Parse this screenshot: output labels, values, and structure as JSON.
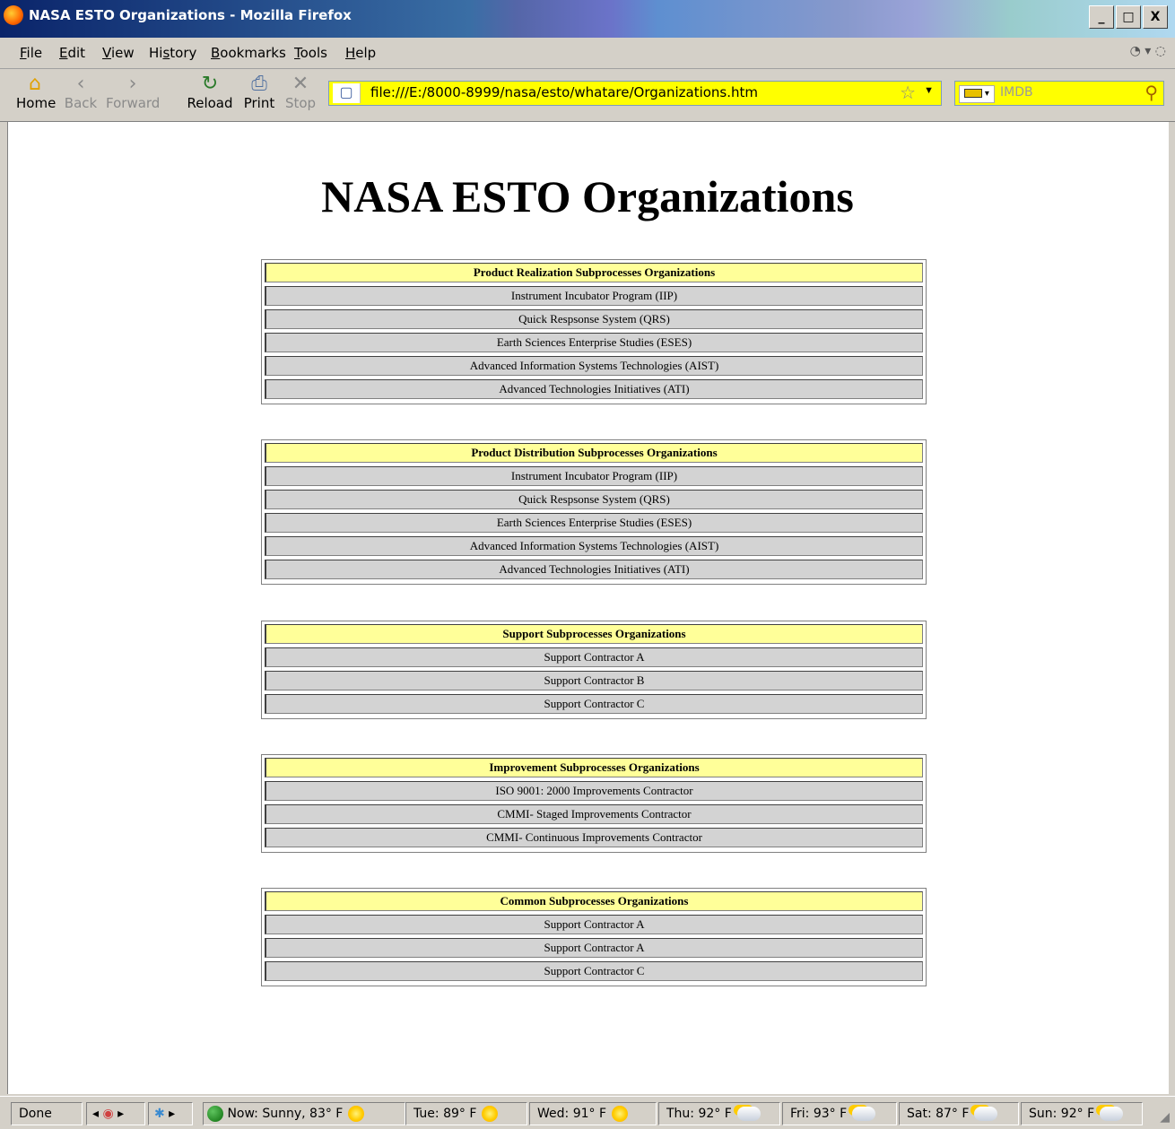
{
  "window": {
    "title": "NASA ESTO Organizations - Mozilla Firefox",
    "controls": {
      "minimize": "_",
      "maximize": "□",
      "close": "X"
    }
  },
  "menu": {
    "items": [
      {
        "label": "File",
        "key": "F",
        "rest": "ile"
      },
      {
        "label": "Edit",
        "key": "E",
        "rest": "dit"
      },
      {
        "label": "View",
        "key": "V",
        "rest": "iew"
      },
      {
        "label": "History",
        "key": "s",
        "pre": "Hi",
        "rest": "tory"
      },
      {
        "label": "Bookmarks",
        "key": "B",
        "rest": "ookmarks"
      },
      {
        "label": "Tools",
        "key": "T",
        "rest": "ools"
      },
      {
        "label": "Help",
        "key": "H",
        "rest": "elp"
      }
    ]
  },
  "toolbar": {
    "home": "Home",
    "back": "Back",
    "forward": "Forward",
    "reload": "Reload",
    "print": "Print",
    "stop": "Stop"
  },
  "address": {
    "url": "file:///E:/8000-8999/nasa/esto/whatare/Organizations.htm"
  },
  "search": {
    "placeholder": "IMDB"
  },
  "page": {
    "title": "NASA ESTO Organizations",
    "tables": [
      {
        "header": "Product Realization Subprocesses Organizations",
        "rows": [
          "Instrument Incubator Program (IIP)",
          "Quick Respsonse System (QRS)",
          "Earth Sciences Enterprise Studies (ESES)",
          "Advanced Information Systems Technologies (AIST)",
          "Advanced Technologies Initiatives (ATI)"
        ]
      },
      {
        "header": "Product Distribution Subprocesses Organizations",
        "rows": [
          "Instrument Incubator Program (IIP)",
          "Quick Respsonse System (QRS)",
          "Earth Sciences Enterprise Studies (ESES)",
          "Advanced Information Systems Technologies (AIST)",
          "Advanced Technologies Initiatives (ATI)"
        ]
      },
      {
        "header": "Support Subprocesses Organizations",
        "rows": [
          "Support Contractor A",
          "Support Contractor B",
          "Support Contractor C"
        ]
      },
      {
        "header": "Improvement Subprocesses Organizations",
        "rows": [
          "ISO 9001: 2000 Improvements Contractor",
          "CMMI- Staged Improvements Contractor",
          "CMMI- Continuous Improvements Contractor"
        ]
      },
      {
        "header": "Common Subprocesses Organizations",
        "rows": [
          "Support Contractor A",
          "Support Contractor A",
          "Support Contractor C"
        ]
      }
    ]
  },
  "status": {
    "text": "Done",
    "weather": [
      {
        "label": "Now: Sunny, 83° F",
        "icon": "sun-icon"
      },
      {
        "label": "Tue: 89° F",
        "icon": "sun-icon"
      },
      {
        "label": "Wed: 91° F",
        "icon": "sun-icon"
      },
      {
        "label": "Thu: 92° F",
        "icon": "partly-cloudy-icon"
      },
      {
        "label": "Fri: 93° F",
        "icon": "partly-cloudy-icon"
      },
      {
        "label": "Sat: 87° F",
        "icon": "partly-cloudy-icon"
      },
      {
        "label": "Sun: 92° F",
        "icon": "partly-cloudy-icon"
      }
    ]
  },
  "colors": {
    "header_cell": "#ffff99",
    "body_cell": "#d3d3d3",
    "url_bar": "#ffff00"
  }
}
